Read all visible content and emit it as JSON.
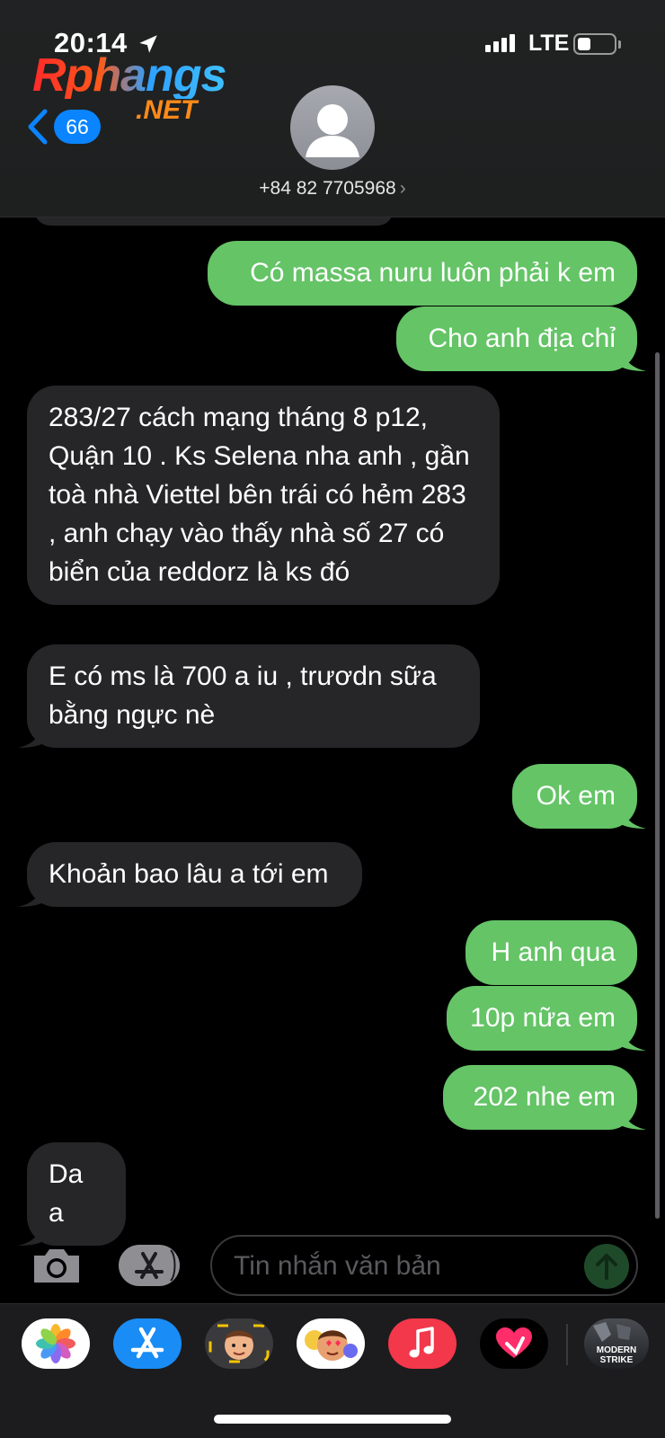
{
  "status_bar": {
    "time": "20:14",
    "network": "LTE",
    "battery_level": 0.25
  },
  "watermark": {
    "main": "Rphangs",
    "sub": ".NET"
  },
  "header": {
    "unread_count": "66",
    "contact": "+84 82 7705968",
    "contact_chevron": "›"
  },
  "messages": [
    {
      "dir": "out",
      "text": "Có massa nuru luôn phải k em"
    },
    {
      "dir": "out",
      "text": "Cho anh địa chỉ"
    },
    {
      "dir": "in",
      "text": "283/27 cách mạng tháng 8 p12, Quận 10 . Ks Selena nha anh , gần toà nhà Viettel bên trái có hẻm 283 , anh chạy vào thấy nhà số 27 có biển của reddorz là ks đó"
    },
    {
      "dir": "in",
      "text": "E có ms là 700 a iu , trươdn sữa bằng ngực nè"
    },
    {
      "dir": "out",
      "text": "Ok em"
    },
    {
      "dir": "in",
      "text": "Khoản bao lâu a tới em"
    },
    {
      "dir": "out",
      "text": "H anh qua"
    },
    {
      "dir": "out",
      "text": "10p nữa em"
    },
    {
      "dir": "out",
      "text": "202 nhe em"
    },
    {
      "dir": "in",
      "text": "Da a"
    }
  ],
  "input": {
    "placeholder": "Tin nhắn văn bản"
  },
  "app_drawer": {
    "apps": [
      "photos-icon",
      "app-store-icon",
      "memoji-icon",
      "animoji-icon",
      "music-icon",
      "digital-touch-icon",
      "modern-strike-icon"
    ],
    "game_label_1": "MODERN",
    "game_label_2": "STRIKE"
  },
  "colors": {
    "outgoing": "#64c466",
    "incoming": "#262628",
    "accent": "#0a84ff"
  }
}
